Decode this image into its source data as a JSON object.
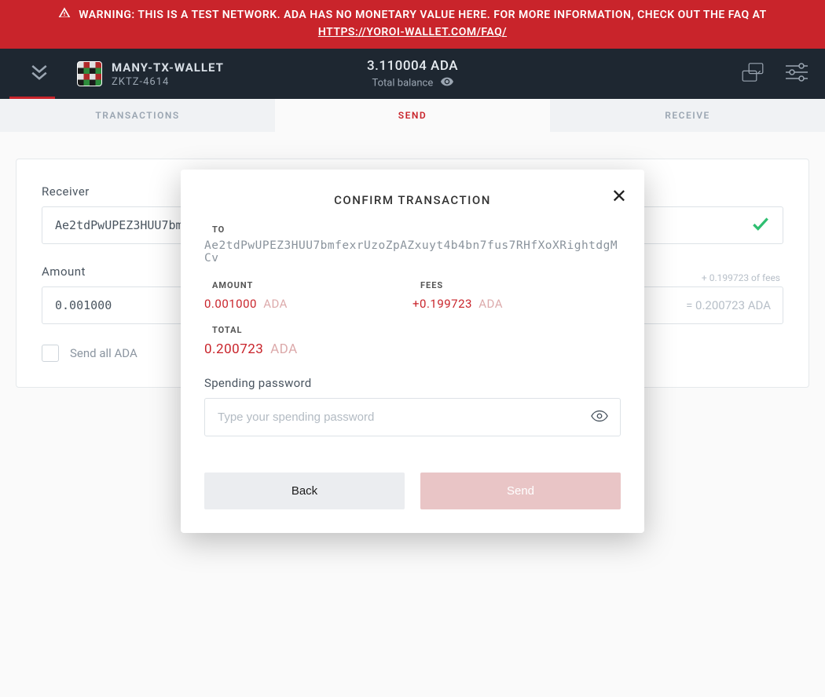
{
  "warning": {
    "text": "WARNING: THIS IS A TEST NETWORK. ADA HAS NO MONETARY VALUE HERE. FOR MORE INFORMATION, CHECK OUT THE FAQ AT ",
    "link_label": "HTTPS://YOROI-WALLET.COM/FAQ/"
  },
  "header": {
    "wallet_name": "MANY-TX-WALLET",
    "wallet_plate": "ZKTZ-4614",
    "balance": "3.110004 ADA",
    "balance_label": "Total balance"
  },
  "tabs": {
    "transactions": "TRANSACTIONS",
    "send": "SEND",
    "receive": "RECEIVE"
  },
  "send_form": {
    "receiver_label": "Receiver",
    "receiver_value": "Ae2tdPwUPEZ3HUU7bm",
    "amount_label": "Amount",
    "amount_value": "0.001000",
    "fees_hint": "+ 0.199723 of fees",
    "total_inline": "= 0.200723 ADA",
    "send_all_label": "Send all ADA"
  },
  "modal": {
    "title": "CONFIRM TRANSACTION",
    "to_label": "TO",
    "to_value": "Ae2tdPwUPEZ3HUU7bmfexrUzoZpAZxuyt4b4bn7fus7RHfXoXRightdgMCv",
    "amount_label": "AMOUNT",
    "amount_num": "0.001000",
    "amount_cur": "ADA",
    "fees_label": "FEES",
    "fees_num": "+0.199723",
    "fees_cur": "ADA",
    "total_label": "TOTAL",
    "total_num": "0.200723",
    "total_cur": "ADA",
    "spending_label": "Spending password",
    "spending_placeholder": "Type your spending password",
    "back_label": "Back",
    "send_label": "Send"
  }
}
